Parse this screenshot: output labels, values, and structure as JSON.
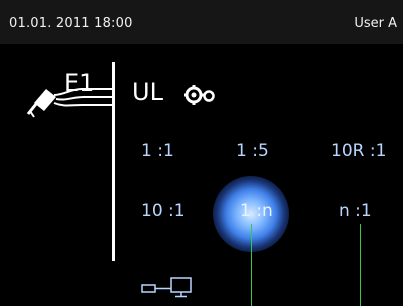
{
  "status_bar": {
    "datetime": "01.01. 2011 18:00",
    "user": "User A"
  },
  "tool": {
    "station": "E1",
    "icon": "welding-tool-icon"
  },
  "mode": {
    "label": "UL",
    "icon": "gear-icon"
  },
  "ratio_options": [
    {
      "label": "1 :1",
      "selected": false
    },
    {
      "label": "1 :5",
      "selected": false
    },
    {
      "label": "10R :1",
      "selected": false
    },
    {
      "label": "10 :1",
      "selected": false
    },
    {
      "label": "1 :n",
      "selected": true
    },
    {
      "label": "n :1",
      "selected": false
    }
  ],
  "colors": {
    "background": "#000000",
    "status_bar": "#161616",
    "option_text": "#b9d6ff",
    "selection_glow": "#3f7fe8",
    "connector_line": "#37c54a"
  },
  "footer": {
    "icon": "network-icon"
  }
}
